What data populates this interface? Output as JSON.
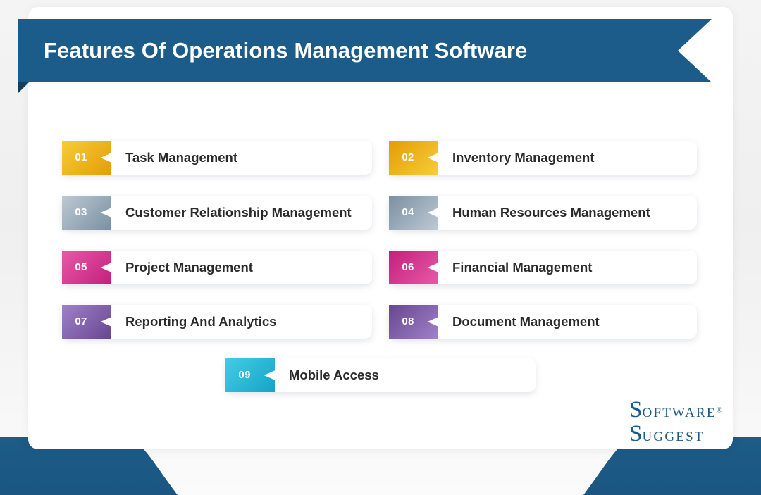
{
  "header": {
    "title": "Features Of Operations Management Software",
    "ribbon_color": "#1b5c8a",
    "fold_color": "#123f5e"
  },
  "card": {
    "background": "#ffffff"
  },
  "page": {
    "background": "#f0f0f0",
    "accent_blue": "#1d5c88"
  },
  "features": [
    {
      "number": "01",
      "label": "Task Management",
      "color_start": "#f6cd3a",
      "color_end": "#e59c06",
      "column": "left"
    },
    {
      "number": "02",
      "label": "Inventory Management",
      "color_start": "#e59c06",
      "color_end": "#f6cd3a",
      "column": "right"
    },
    {
      "number": "03",
      "label": "Customer Relationship Management",
      "color_start": "#bdc9d3",
      "color_end": "#7a90a2",
      "column": "left"
    },
    {
      "number": "04",
      "label": "Human Resources Management",
      "color_start": "#7a90a2",
      "color_end": "#bdc9d3",
      "column": "right"
    },
    {
      "number": "05",
      "label": "Project Management",
      "color_start": "#e75aa6",
      "color_end": "#c31f7d",
      "column": "left"
    },
    {
      "number": "06",
      "label": "Financial Management",
      "color_start": "#c31f7d",
      "color_end": "#e75aa6",
      "column": "right"
    },
    {
      "number": "07",
      "label": "Reporting And Analytics",
      "color_start": "#a082c9",
      "color_end": "#67468f",
      "column": "left"
    },
    {
      "number": "08",
      "label": "Document Management",
      "color_start": "#67468f",
      "color_end": "#a082c9",
      "column": "right"
    },
    {
      "number": "09",
      "label": "Mobile Access",
      "color_start": "#42cde5",
      "color_end": "#17a3c6",
      "column": "center"
    }
  ],
  "logo": {
    "line1_cap": "S",
    "line1_rest": "OFTWARE",
    "registered": "®",
    "line2_cap": "S",
    "line2_rest": "UGGEST",
    "color": "#1c5a88"
  }
}
